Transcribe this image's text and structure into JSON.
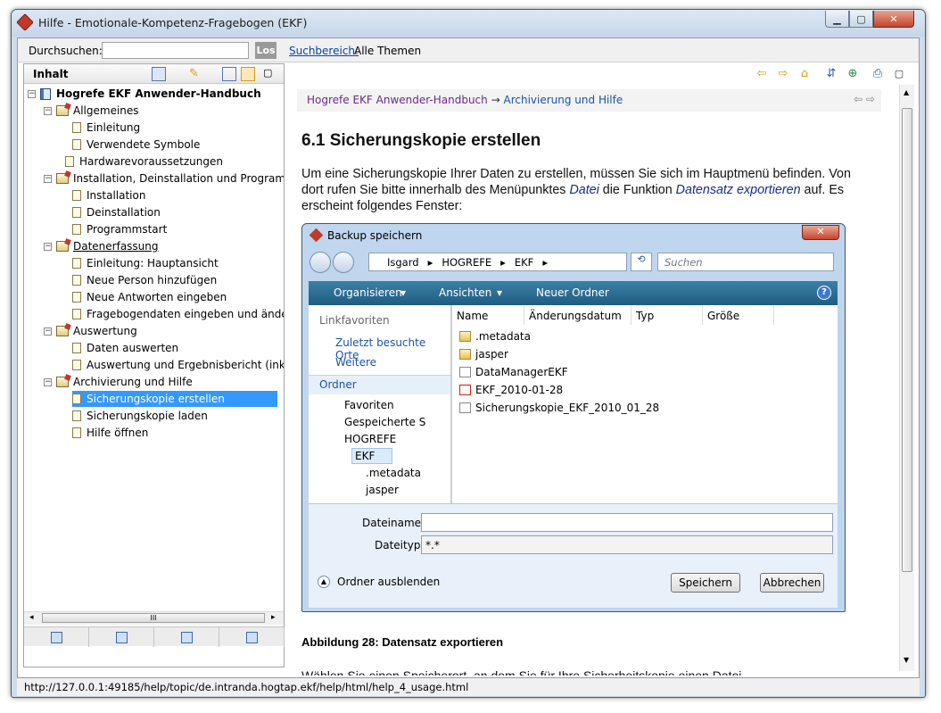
{
  "window": {
    "title": "Hilfe - Emotionale-Kompetenz-Fragebogen (EKF)"
  },
  "search": {
    "label": "Durchsuchen:",
    "go": "Los",
    "scope_link": "Suchbereich:",
    "scope_value": "Alle Themen"
  },
  "left_pane": {
    "title": "Inhalt",
    "tree": [
      {
        "label": "Hogrefe EKF Anwender-Handbuch",
        "icon": "book-icon",
        "level": 0,
        "bold": true
      },
      {
        "label": "Allgemeines",
        "icon": "folder-topic-icon",
        "level": 1
      },
      {
        "label": "Einleitung",
        "icon": "page-icon",
        "level": 2
      },
      {
        "label": "Verwendete Symbole",
        "icon": "page-icon",
        "level": 2
      },
      {
        "label": "Hardwarevoraussetzungen",
        "icon": "page-icon",
        "level": 1
      },
      {
        "label": "Installation, Deinstallation und Programmsta",
        "icon": "folder-topic-icon",
        "level": 1
      },
      {
        "label": "Installation",
        "icon": "page-icon",
        "level": 2
      },
      {
        "label": "Deinstallation",
        "icon": "page-icon",
        "level": 2
      },
      {
        "label": "Programmstart",
        "icon": "page-icon",
        "level": 2
      },
      {
        "label": "Datenerfassung",
        "icon": "folder-topic-icon",
        "level": 1
      },
      {
        "label": "Einleitung: Hauptansicht",
        "icon": "page-icon",
        "level": 2
      },
      {
        "label": "Neue Person hinzufügen",
        "icon": "page-icon",
        "level": 2
      },
      {
        "label": "Neue Antworten eingeben",
        "icon": "page-icon",
        "level": 2
      },
      {
        "label": "Fragebogendaten eingeben und ändern",
        "icon": "page-icon",
        "level": 2
      },
      {
        "label": "Auswertung",
        "icon": "folder-topic-icon",
        "level": 1
      },
      {
        "label": "Daten auswerten",
        "icon": "page-icon",
        "level": 2
      },
      {
        "label": "Auswertung und Ergebnisbericht (inkl. Dr",
        "icon": "page-icon",
        "level": 2
      },
      {
        "label": "Archivierung und Hilfe",
        "icon": "folder-topic-icon",
        "level": 1
      },
      {
        "label": "Sicherungskopie erstellen",
        "icon": "page-icon",
        "level": 2,
        "selected": true
      },
      {
        "label": "Sicherungskopie laden",
        "icon": "page-icon",
        "level": 2
      },
      {
        "label": "Hilfe öffnen",
        "icon": "page-icon",
        "level": 2
      }
    ],
    "hscroll_label": "III"
  },
  "content": {
    "crumb_root": "Hogrefe EKF Anwender-Handbuch",
    "crumb_arrow": "→",
    "crumb_current": "Archivierung und Hilfe",
    "heading": "6.1 Sicherungskopie erstellen",
    "para_1": "Um eine Sicherungskopie Ihrer Daten zu erstellen, müssen Sie sich im Hauptmenü befinden. Von dort rufen Sie bitte innerhalb des Menüpunktes ",
    "para_datei": "Datei",
    "para_2": " die Funktion ",
    "para_export": "Datensatz exportieren",
    "para_3": " auf. Es erscheint folgendes Fenster:",
    "caption": "Abbildung 28: Datensatz exportieren",
    "cut_text": "Wählen Sie einen Speicherort, an dem Sie für Ihre Sicherheitskopie einen Datei"
  },
  "dialog": {
    "title": "Backup speichern",
    "path": [
      "Isgard",
      "HOGREFE",
      "EKF"
    ],
    "search_placeholder": "Suchen",
    "cmd_organize": "Organisieren",
    "cmd_views": "Ansichten",
    "cmd_newfolder": "Neuer Ordner",
    "nav_favorites_header": "Linkfavoriten",
    "nav_recent": "Zuletzt besuchte Orte",
    "nav_more": "Weitere",
    "nav_folders_header": "Ordner",
    "nav_tree": [
      "Favoriten",
      "Gespeicherte S",
      "HOGREFE",
      "EKF",
      ".metadata",
      "jasper"
    ],
    "columns": [
      "Name",
      "Änderungsdatum",
      "Typ",
      "Größe"
    ],
    "files": [
      {
        "name": ".metadata",
        "icon": "folder-icon"
      },
      {
        "name": "jasper",
        "icon": "folder-icon"
      },
      {
        "name": "DataManagerEKF",
        "icon": "document-icon"
      },
      {
        "name": "EKF_2010-01-28",
        "icon": "pdf-icon"
      },
      {
        "name": "Sicherungskopie_EKF_2010_01_28",
        "icon": "blank-file-icon"
      }
    ],
    "filename_label": "Dateiname:",
    "filename_value": "",
    "filetype_label": "Dateityp:",
    "filetype_value": "*.*",
    "hide_folders": "Ordner ausblenden",
    "save": "Speichern",
    "cancel": "Abbrechen"
  },
  "status": {
    "url": "http://127.0.0.1:49185/help/topic/de.intranda.hogtap.ekf/help/html/help_4_usage.html"
  }
}
